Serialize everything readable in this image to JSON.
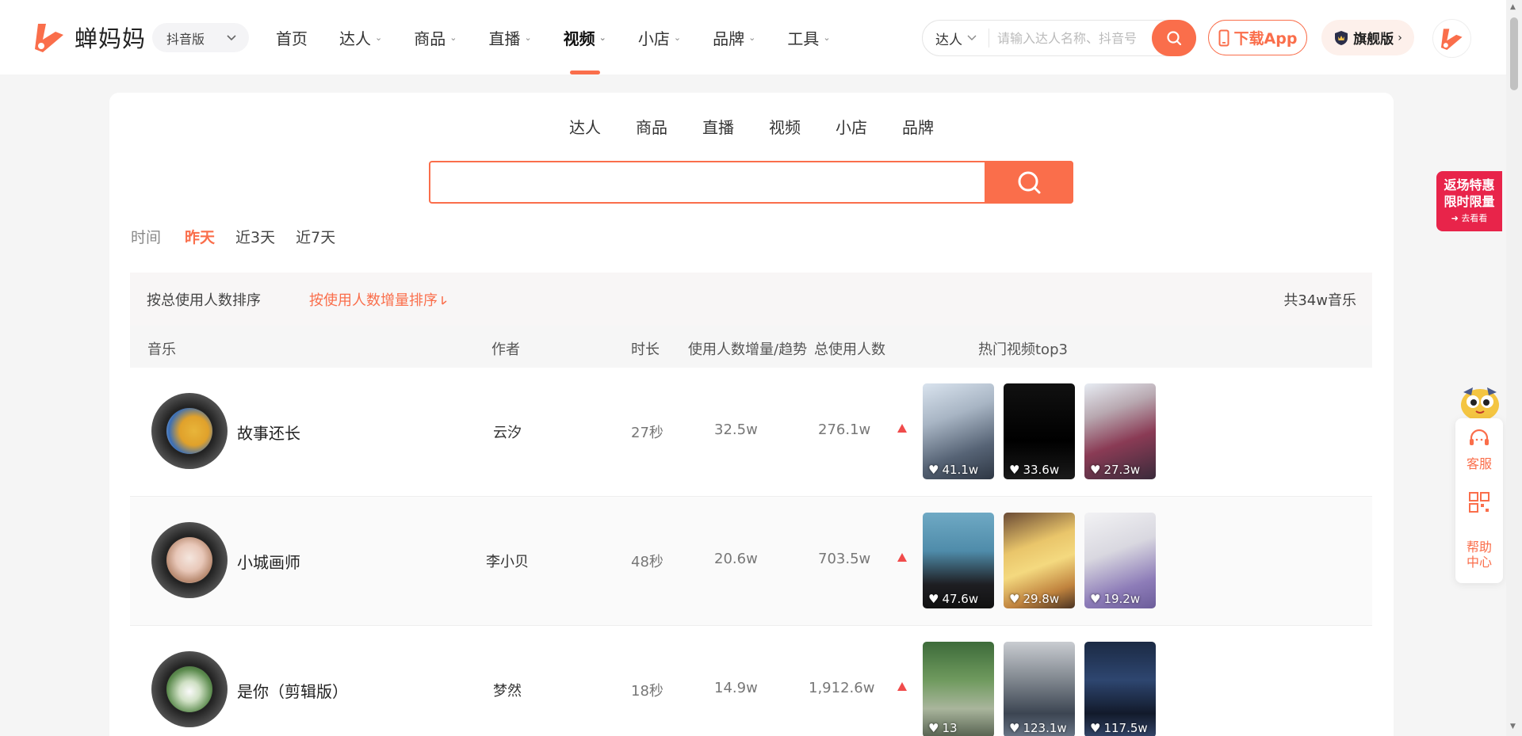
{
  "brand": {
    "name": "蝉妈妈",
    "accent": "#fa6e4b"
  },
  "platform": {
    "label": "抖音版"
  },
  "nav": {
    "items": [
      {
        "label": "首页",
        "has_dropdown": false,
        "active": false
      },
      {
        "label": "达人",
        "has_dropdown": true,
        "active": false
      },
      {
        "label": "商品",
        "has_dropdown": true,
        "active": false
      },
      {
        "label": "直播",
        "has_dropdown": true,
        "active": false
      },
      {
        "label": "视频",
        "has_dropdown": true,
        "active": true
      },
      {
        "label": "小店",
        "has_dropdown": true,
        "active": false
      },
      {
        "label": "品牌",
        "has_dropdown": true,
        "active": false
      },
      {
        "label": "工具",
        "has_dropdown": true,
        "active": false
      }
    ]
  },
  "header_search": {
    "type_label": "达人",
    "placeholder": "请输入达人名称、抖音号"
  },
  "download_label": "下载App",
  "flagship_label": "旗舰版",
  "category_tabs": [
    "达人",
    "商品",
    "直播",
    "视频",
    "小店",
    "品牌"
  ],
  "main_search": {
    "value": ""
  },
  "time_filter": {
    "label": "时间",
    "options": [
      "昨天",
      "近3天",
      "近7天"
    ],
    "selected": "昨天"
  },
  "sort": {
    "by_total": "按总使用人数排序",
    "by_increase": "按使用人数增量排序",
    "total_count": "共34w音乐"
  },
  "columns": {
    "music": "音乐",
    "author": "作者",
    "duration": "时长",
    "increase": "使用人数增量/趋势",
    "total": "总使用人数",
    "top_videos": "热门视频top3"
  },
  "rows": [
    {
      "title": "故事还长",
      "author": "云汐",
      "duration": "27秒",
      "increase": "32.5w",
      "total": "276.1w",
      "videos": [
        {
          "likes": "41.1w"
        },
        {
          "likes": "33.6w"
        },
        {
          "likes": "27.3w"
        }
      ]
    },
    {
      "title": "小城画师",
      "author": "李小贝",
      "duration": "48秒",
      "increase": "20.6w",
      "total": "703.5w",
      "videos": [
        {
          "likes": "47.6w"
        },
        {
          "likes": "29.8w"
        },
        {
          "likes": "19.2w"
        }
      ]
    },
    {
      "title": "是你（剪辑版）",
      "author": "梦然",
      "duration": "18秒",
      "increase": "14.9w",
      "total": "1,912.6w",
      "videos": [
        {
          "likes": "13"
        },
        {
          "likes": "123.1w"
        },
        {
          "likes": "117.5w"
        }
      ]
    }
  ],
  "promo": {
    "line1": "返场特惠",
    "line2": "限时限量",
    "line3": "去看看",
    "color": "#e8244a"
  },
  "float_panel": {
    "service": "客服",
    "help_line1": "帮助",
    "help_line2": "中心"
  }
}
